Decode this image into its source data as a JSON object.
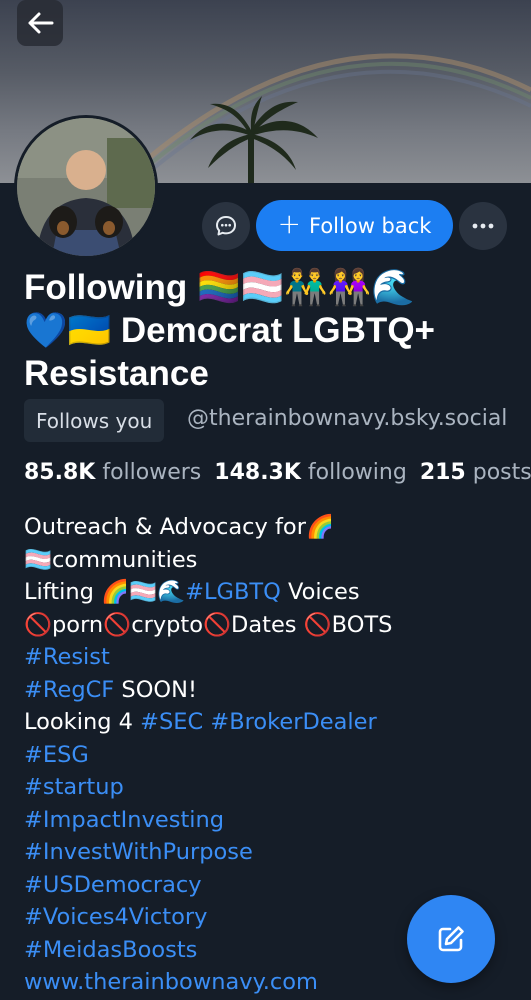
{
  "header": {
    "back_icon": "arrow-left-icon"
  },
  "profile": {
    "name_line1": "Following 🏳️‍🌈🏳️‍⚧️👬👭🌊",
    "name_line2": "💙🇺🇦 Democrat LGBTQ+",
    "name_line3": "Resistance",
    "follows_you": "Follows you",
    "handle": "@therainbownavy.bsky.social"
  },
  "actions": {
    "message_icon": "chat-bubble-icon",
    "follow_back_label": "Follow back",
    "follow_plus": "+",
    "more_icon": "more-horizontal-icon"
  },
  "stats": {
    "followers_count": "85.8K",
    "followers_label": "followers",
    "following_count": "148.3K",
    "following_label": "following",
    "posts_count": "215",
    "posts_label": "posts"
  },
  "bio": {
    "l1_text": "Outreach & Advocacy for🌈",
    "l2_text": "🏳️‍⚧️communities",
    "l3_pre": "Lifting 🌈🏳️‍⚧️🌊",
    "l3_tag": "#LGBTQ",
    "l3_post": " Voices",
    "l4_text": "🚫porn🚫crypto🚫Dates 🚫BOTS",
    "l5_tag": "#Resist",
    "l6_tag": "#RegCF",
    "l6_post": " SOON!",
    "l7_pre": "Looking 4 ",
    "l7_tag1": "#SEC",
    "l7_tag2": "#BrokerDealer",
    "l8_tag": "#ESG",
    "l9_tag": "#startup",
    "l10_tag": "#ImpactInvesting",
    "l11_tag": "#InvestWithPurpose",
    "l12_tag": "#USDemocracy",
    "l13_tag": "#Voices4Victory",
    "l14_tag": "#MeidasBoosts",
    "l15_link": "www.therainbownavy.com"
  },
  "fab": {
    "compose_icon": "edit-pencil-icon"
  },
  "colors": {
    "background": "#151d28",
    "accent": "#1c7ef2",
    "link": "#3b8ef5",
    "muted_text": "#aab4c0"
  }
}
